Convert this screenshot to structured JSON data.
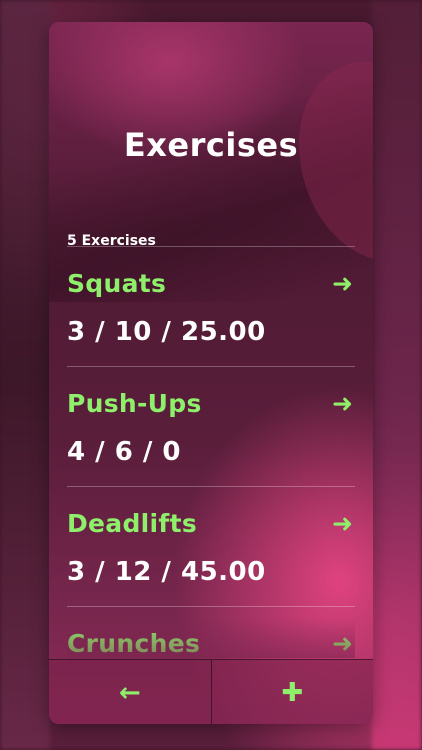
{
  "header": {
    "title": "Exercises",
    "count_label": "5 Exercises"
  },
  "exercises": [
    {
      "name": "Squats",
      "stats": "3 / 10 / 25.00"
    },
    {
      "name": "Push-Ups",
      "stats": "4 / 6 / 0"
    },
    {
      "name": "Deadlifts",
      "stats": "3 / 12 / 45.00"
    },
    {
      "name": "Crunches",
      "stats": ""
    }
  ],
  "icons": {
    "row_arrow": "arrow-right-icon",
    "back": "arrow-left-icon",
    "add": "plus-icon"
  },
  "glyphs": {
    "row_arrow": "➜",
    "back": "←",
    "add": "✚"
  },
  "colors": {
    "accent": "#8ef06a",
    "text": "#ffffff",
    "card_top": "#7a2650",
    "card_highlight": "#e0437f"
  }
}
